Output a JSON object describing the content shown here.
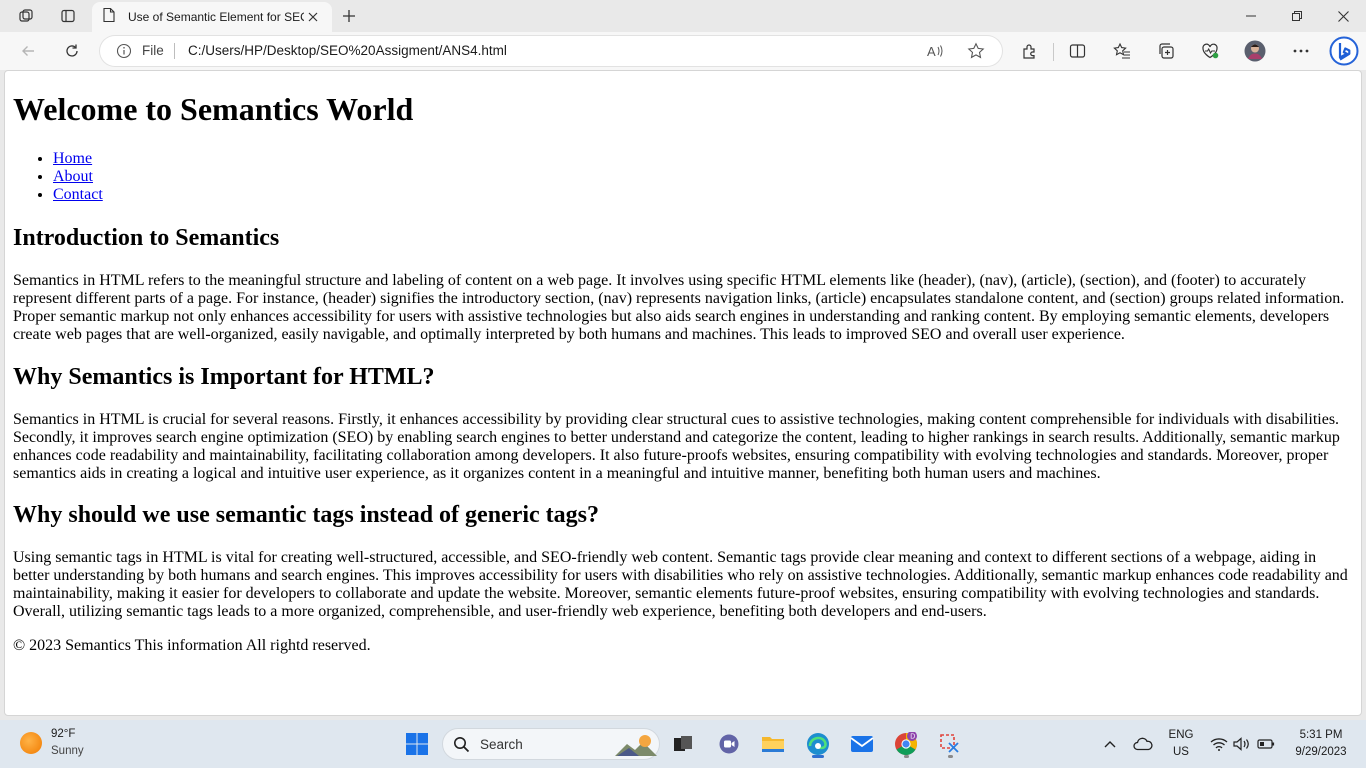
{
  "browser": {
    "tab_title": "Use of Semantic Element for SEO",
    "address_prefix": "File",
    "address_url": "C:/Users/HP/Desktop/SEO%20Assigment/ANS4.html",
    "icons": [
      "workspaces-icon",
      "tab-actions-icon",
      "page-icon",
      "close-icon",
      "new-tab-icon",
      "minimize-icon",
      "restore-icon",
      "window-close-icon",
      "back-icon",
      "refresh-icon",
      "info-icon",
      "read-aloud-icon",
      "favorite-star-icon",
      "extensions-icon",
      "split-screen-icon",
      "favorites-icon",
      "collections-icon",
      "browser-essentials-icon",
      "profile-avatar",
      "more-menu-icon",
      "copilot-icon"
    ]
  },
  "page": {
    "h1": "Welcome to Semantics World",
    "nav": [
      "Home",
      "About",
      "Contact"
    ],
    "sections": [
      {
        "heading": "Introduction to Semantics",
        "body": "Semantics in HTML refers to the meaningful structure and labeling of content on a web page. It involves using specific HTML elements like (header), (nav), (article), (section), and (footer) to accurately represent different parts of a page. For instance, (header) signifies the introductory section, (nav) represents navigation links, (article) encapsulates standalone content, and (section) groups related information. Proper semantic markup not only enhances accessibility for users with assistive technologies but also aids search engines in understanding and ranking content. By employing semantic elements, developers create web pages that are well-organized, easily navigable, and optimally interpreted by both humans and machines. This leads to improved SEO and overall user experience."
      },
      {
        "heading": "Why Semantics is Important for HTML?",
        "body": "Semantics in HTML is crucial for several reasons. Firstly, it enhances accessibility by providing clear structural cues to assistive technologies, making content comprehensible for individuals with disabilities. Secondly, it improves search engine optimization (SEO) by enabling search engines to better understand and categorize the content, leading to higher rankings in search results. Additionally, semantic markup enhances code readability and maintainability, facilitating collaboration among developers. It also future-proofs websites, ensuring compatibility with evolving technologies and standards. Moreover, proper semantics aids in creating a logical and intuitive user experience, as it organizes content in a meaningful and intuitive manner, benefiting both human users and machines."
      },
      {
        "heading": "Why should we use semantic tags instead of generic tags?",
        "body": "Using semantic tags in HTML is vital for creating well-structured, accessible, and SEO-friendly web content. Semantic tags provide clear meaning and context to different sections of a webpage, aiding in better understanding by both humans and search engines. This improves accessibility for users with disabilities who rely on assistive technologies. Additionally, semantic markup enhances code readability and maintainability, making it easier for developers to collaborate and update the website. Moreover, semantic elements future-proof websites, ensuring compatibility with evolving technologies and standards. Overall, utilizing semantic tags leads to a more organized, comprehensible, and user-friendly web experience, benefiting both developers and end-users."
      }
    ],
    "footer": "© 2023 Semantics This information All rightd reserved."
  },
  "taskbar": {
    "weather_temp": "92°F",
    "weather_condition": "Sunny",
    "search_placeholder": "Search",
    "language_primary": "ENG",
    "language_region": "US",
    "time": "5:31 PM",
    "date": "9/29/2023",
    "colors": {
      "accent": "#2f6fd0",
      "background": "#dfe7ef"
    }
  }
}
